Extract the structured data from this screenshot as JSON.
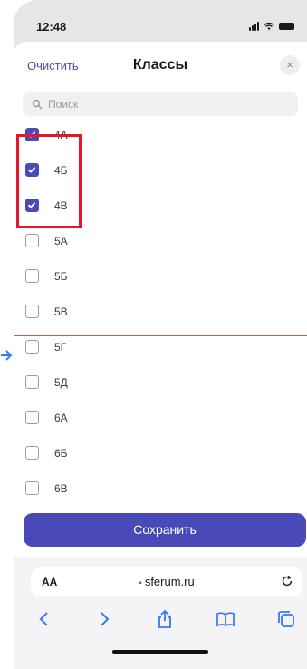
{
  "status_bar": {
    "time": "12:48"
  },
  "sheet": {
    "clear_label": "Очистить",
    "title": "Классы",
    "close_label": "×"
  },
  "search": {
    "placeholder": "Поиск"
  },
  "classes": [
    {
      "label": "4А",
      "checked": true
    },
    {
      "label": "4Б",
      "checked": true
    },
    {
      "label": "4В",
      "checked": true
    },
    {
      "label": "5А",
      "checked": false
    },
    {
      "label": "5Б",
      "checked": false
    },
    {
      "label": "5В",
      "checked": false
    },
    {
      "label": "5Г",
      "checked": false
    },
    {
      "label": "5Д",
      "checked": false
    },
    {
      "label": "6А",
      "checked": false
    },
    {
      "label": "6Б",
      "checked": false
    },
    {
      "label": "6В",
      "checked": false
    }
  ],
  "save_label": "Сохранить",
  "browser": {
    "text_size_label": "AA",
    "url": "sferum.ru"
  },
  "colors": {
    "accent": "#4a49b8",
    "highlight": "#e5152b",
    "guide_line": "#e74c3c",
    "guide_arrow": "#2d7ff9"
  }
}
